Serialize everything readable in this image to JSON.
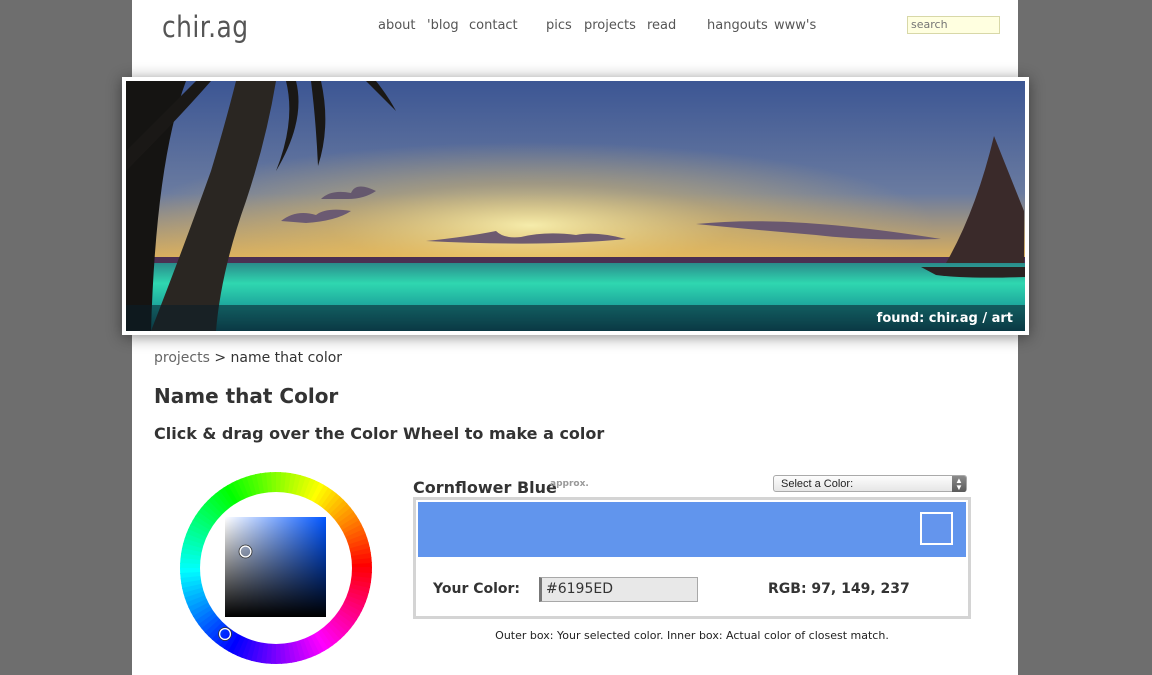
{
  "header": {
    "logo": "chir.ag",
    "nav": [
      "about",
      "'blog",
      "contact",
      "pics",
      "projects",
      "read",
      "hangouts",
      "www's"
    ],
    "search_placeholder": "search"
  },
  "banner": {
    "caption": "found: chir.ag / art"
  },
  "breadcrumb": {
    "parent": "projects",
    "separator": ">",
    "current": "name that color"
  },
  "page": {
    "title": "Name that Color",
    "subtitle": "Click & drag over the Color Wheel to make a color"
  },
  "color_result": {
    "name": "Cornflower Blue",
    "approx_label": "approx.",
    "select_label": "Select a Color:",
    "your_color_label": "Your Color:",
    "hex_value": "#6195ED",
    "rgb_text": "RGB: 97, 149, 237",
    "selected_color": "#6195ED",
    "match_color": "#6495ED"
  },
  "note": "Outer box: Your selected color. Inner box: Actual color of closest match."
}
